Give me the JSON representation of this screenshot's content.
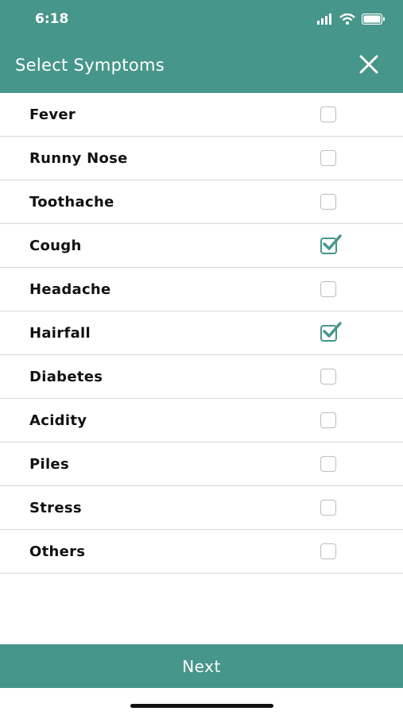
{
  "status_bar": {
    "time": "6:18"
  },
  "header": {
    "title": "Select Symptoms",
    "close_icon": "close-icon"
  },
  "symptoms": [
    {
      "label": "Fever",
      "checked": false
    },
    {
      "label": "Runny Nose",
      "checked": false
    },
    {
      "label": "Toothache",
      "checked": false
    },
    {
      "label": "Cough",
      "checked": true
    },
    {
      "label": "Headache",
      "checked": false
    },
    {
      "label": "Hairfall",
      "checked": true
    },
    {
      "label": "Diabetes",
      "checked": false
    },
    {
      "label": "Acidity",
      "checked": false
    },
    {
      "label": "Piles",
      "checked": false
    },
    {
      "label": "Stress",
      "checked": false
    },
    {
      "label": "Others",
      "checked": false
    }
  ],
  "footer": {
    "next_label": "Next"
  },
  "colors": {
    "accent": "#47968a",
    "divider": "#d6d6d6"
  }
}
